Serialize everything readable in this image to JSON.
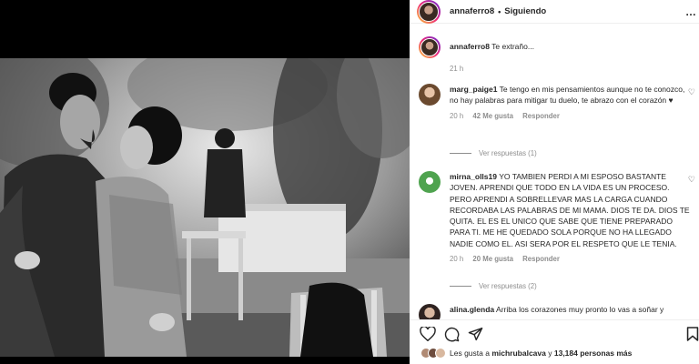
{
  "header": {
    "username": "annaferro8",
    "separator": "•",
    "follow_status": "Siguiendo",
    "more_icon": "…"
  },
  "caption": {
    "username": "annaferro8",
    "text": "Te extraño...",
    "time": "21 h"
  },
  "comments": [
    {
      "username": "marg_paige1",
      "text": "Te tengo en mis pensamientos aunque no te conozco, no hay palabras para mitigar tu duelo, te abrazo con el corazón ♥",
      "time": "20 h",
      "likes": "42 Me gusta",
      "reply_label": "Responder",
      "view_replies": "Ver respuestas (1)"
    },
    {
      "username": "mirna_olls19",
      "text": "YO TAMBIEN PERDI A MI ESPOSO BASTANTE JOVEN. APRENDI QUE TODO EN LA VIDA ES UN PROCESO. PERO APRENDI A SOBRELLEVAR MAS LA CARGA CUANDO RECORDABA LAS PALABRAS DE MI MAMA. DIOS TE DA. DIOS TE QUITA. EL ES EL UNICO QUE SABE QUE TIENE PREPARADO PARA TI. ME HE QUEDADO SOLA PORQUE NO HA LLEGADO NADIE COMO EL. ASI SERA POR EL RESPETO QUE LE TENIA.",
      "time": "20 h",
      "likes": "20 Me gusta",
      "reply_label": "Responder",
      "view_replies": "Ver respuestas (2)"
    },
    {
      "username": "alina.glenda",
      "text": "Arriba los corazones muy pronto lo vas a soñar y"
    }
  ],
  "footer": {
    "likes_prefix": "Les gusta a",
    "liked_by": "michrubalcava",
    "likes_middle": "y",
    "likes_count": "13,184 personas más"
  }
}
